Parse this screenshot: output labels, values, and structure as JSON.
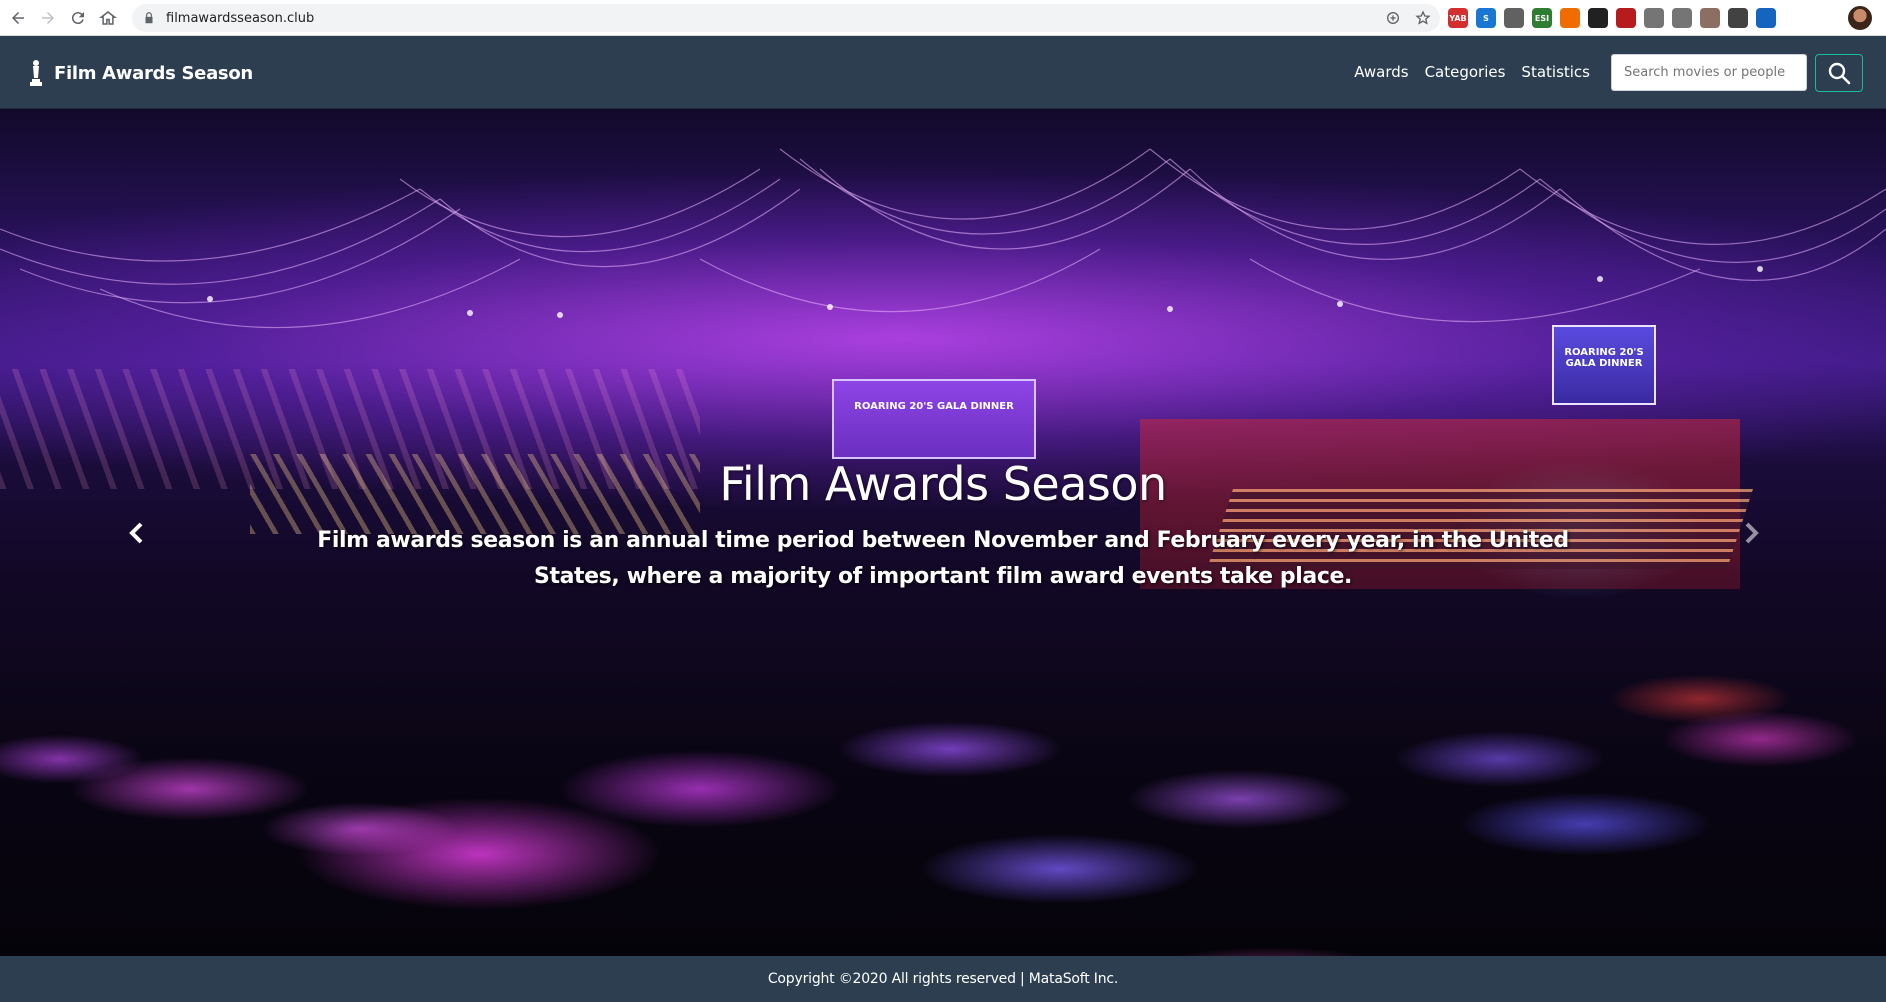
{
  "browser": {
    "url": "filmawardsseason.club",
    "nav_icons": [
      "back-icon",
      "forward-icon",
      "reload-icon",
      "home-icon"
    ],
    "omnibox_icons": [
      "zoom-icon",
      "bookmark-star-icon"
    ],
    "extensions": [
      {
        "name": "yab-extension-icon",
        "label": "YAB",
        "color": "#d32f2f"
      },
      {
        "name": "s-extension-icon",
        "label": "S",
        "color": "#1976d2"
      },
      {
        "name": "ring-extension-icon",
        "label": "",
        "color": "#616161"
      },
      {
        "name": "esi-extension-icon",
        "label": "ESI",
        "color": "#2e7d32"
      },
      {
        "name": "face-extension-icon",
        "label": "",
        "color": "#ef6c00"
      },
      {
        "name": "bird-extension-icon",
        "label": "",
        "color": "#212121"
      },
      {
        "name": "red-square-extension-icon",
        "label": "",
        "color": "#b71c1c"
      },
      {
        "name": "recycle-extension-icon",
        "label": "",
        "color": "#757575"
      },
      {
        "name": "pocket-extension-icon",
        "label": "",
        "color": "#757575"
      },
      {
        "name": "image-extension-icon",
        "label": "",
        "color": "#8d6e63"
      },
      {
        "name": "eyedropper-extension-icon",
        "label": "",
        "color": "#424242"
      },
      {
        "name": "grid-extension-icon",
        "label": "",
        "color": "#1565c0"
      }
    ]
  },
  "navbar": {
    "brand": "Film Awards Season",
    "links": [
      "Awards",
      "Categories",
      "Statistics"
    ],
    "search_placeholder": "Search movies or people",
    "accent_color": "#18bc9c",
    "background_color": "#2c3e50"
  },
  "hero": {
    "title": "Film Awards Season",
    "text": "Film awards season is an annual time period between November and February every year, in the United States, where a majority of important film award events take place.",
    "screen_text": "ROARING 20'S GALA DINNER"
  },
  "footer": {
    "text": "Copyright ©2020 All rights reserved | MataSoft Inc."
  }
}
